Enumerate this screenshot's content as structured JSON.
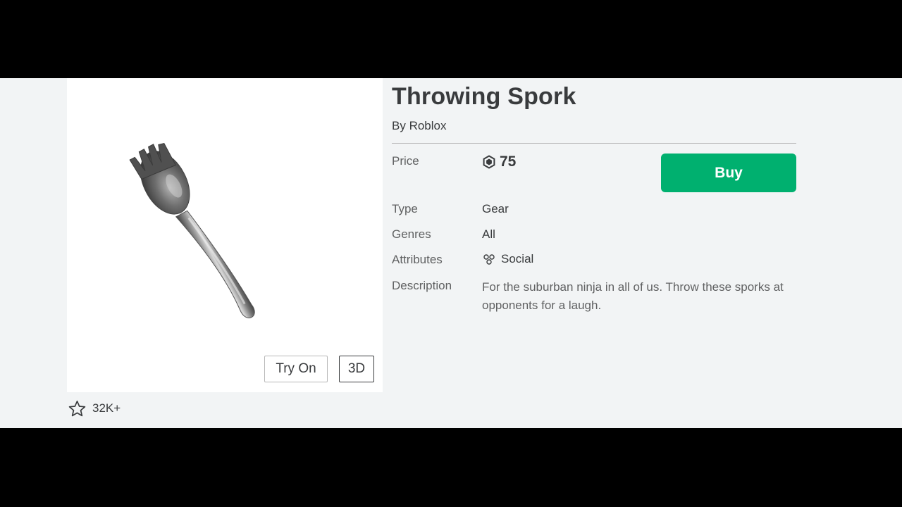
{
  "item": {
    "title": "Throwing Spork",
    "creator_prefix": "By",
    "creator_name": "Roblox"
  },
  "thumbnail": {
    "try_on_label": "Try On",
    "view_3d_label": "3D",
    "image": "spork-render"
  },
  "favorites": {
    "icon": "star-outline-icon",
    "count": "32K+"
  },
  "details": {
    "price_label": "Price",
    "price_icon": "robux-icon",
    "price_value": "75",
    "buy_label": "Buy",
    "type_label": "Type",
    "type_value": "Gear",
    "genres_label": "Genres",
    "genres_value": "All",
    "attributes_label": "Attributes",
    "attributes_icon": "social-icon",
    "attributes_value": "Social",
    "description_label": "Description",
    "description_value": "For the suburban ninja in all of us. Throw these sporks at opponents for a laugh."
  },
  "colors": {
    "buy_button": "#00b06f",
    "text_primary": "#393b3d",
    "text_secondary": "#606162",
    "page_background": "#f2f4f5"
  }
}
